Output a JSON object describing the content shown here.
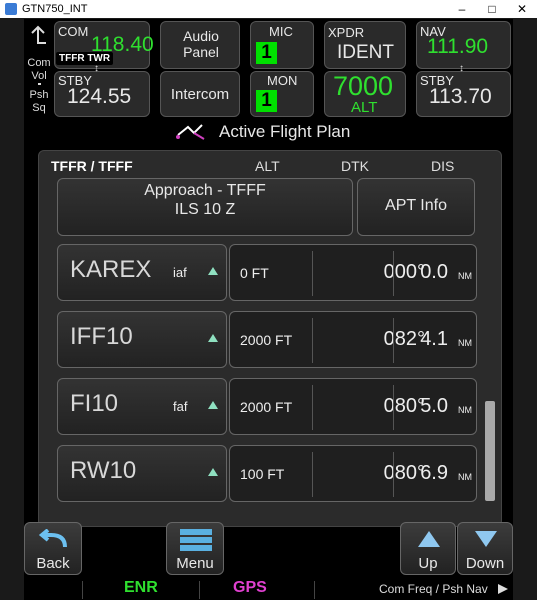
{
  "window": {
    "title": "GTN750_INT",
    "min": "–",
    "max": "□",
    "close": "✕"
  },
  "com": {
    "label": "COM",
    "active": "118.40",
    "stby_label": "STBY",
    "stby": "124.55",
    "tag": "TFFR TWR",
    "side_vol": "Com Vol",
    "side_psh": "Psh Sq"
  },
  "audio": {
    "panel": "Audio Panel",
    "intercom": "Intercom"
  },
  "mic": {
    "label": "MIC",
    "value": "1"
  },
  "mon": {
    "label": "MON",
    "value": "1"
  },
  "xpdr": {
    "label": "XPDR",
    "ident": "IDENT",
    "code": "7000",
    "mode": "ALT"
  },
  "nav": {
    "label": "NAV",
    "active": "111.90",
    "stby_label": "STBY",
    "stby": "113.70"
  },
  "page_title": "Active Flight Plan",
  "flightplan": {
    "route": "TFFR / TFFF",
    "col_alt": "ALT",
    "col_dtk": "DTK",
    "col_dis": "DIS",
    "approach_line1": "Approach - TFFF",
    "approach_line2": "ILS 10 Z",
    "apt_info": "APT Info",
    "rows": [
      {
        "wpt": "KAREX",
        "tag": "iaf",
        "alt": "0 FT",
        "dtk": "000°",
        "dis": "0.0",
        "unit": "NM"
      },
      {
        "wpt": "IFF10",
        "tag": "",
        "alt": "2000 FT",
        "dtk": "082°",
        "dis": "4.1",
        "unit": "NM"
      },
      {
        "wpt": "FI10",
        "tag": "faf",
        "alt": "2000 FT",
        "dtk": "080°",
        "dis": "5.0",
        "unit": "NM"
      },
      {
        "wpt": "RW10",
        "tag": "",
        "alt": "100 FT",
        "dtk": "080°",
        "dis": "6.9",
        "unit": "NM"
      }
    ]
  },
  "buttons": {
    "back": "Back",
    "menu": "Menu",
    "up": "Up",
    "down": "Down"
  },
  "status": {
    "enr": "ENR",
    "gps": "GPS",
    "hint": "Com Freq / Psh Nav"
  }
}
